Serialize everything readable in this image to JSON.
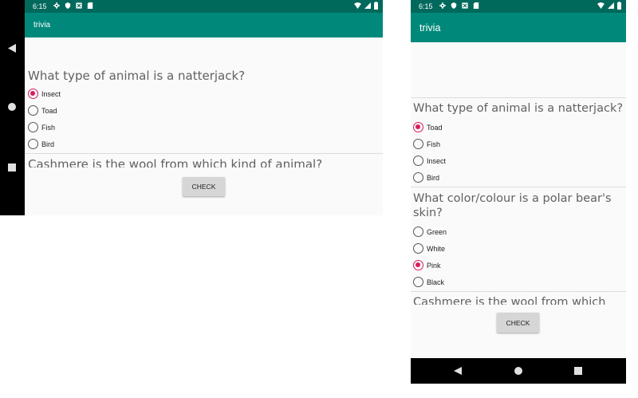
{
  "status": {
    "time": "6:15",
    "icons": [
      "settings-icon",
      "shield-icon",
      "app-icon",
      "sd-card-icon"
    ],
    "right_icons": [
      "wifi-icon",
      "signal-icon",
      "battery-icon"
    ]
  },
  "app": {
    "title": "trivia"
  },
  "colors": {
    "status_bar": "#00695c",
    "app_bar": "#00897b",
    "accent": "#d81b60",
    "background": "#fafafa",
    "button": "#d6d6d6"
  },
  "landscape": {
    "q1": {
      "text": "What type of animal is a natterjack?",
      "options": [
        "Insect",
        "Toad",
        "Fish",
        "Bird"
      ],
      "selected": 0
    },
    "q2": {
      "text": "Cashmere is the wool from which kind of animal?"
    },
    "check_label": "CHECK"
  },
  "portrait": {
    "q1": {
      "text": "What type of animal is a natterjack?",
      "options": [
        "Toad",
        "Fish",
        "Insect",
        "Bird"
      ],
      "selected": 0
    },
    "q2": {
      "text": "What color/colour is a polar bear's skin?",
      "options": [
        "Green",
        "White",
        "Pink",
        "Black"
      ],
      "selected": 2
    },
    "q3": {
      "text": "Cashmere is the wool from which"
    },
    "check_label": "CHECK"
  },
  "nav": [
    "back-icon",
    "home-icon",
    "recents-icon"
  ]
}
